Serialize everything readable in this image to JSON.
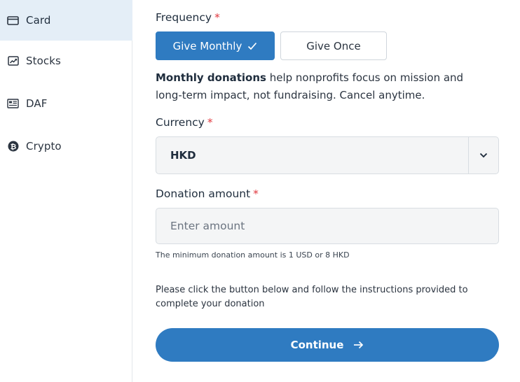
{
  "sidebar": {
    "items": [
      {
        "label": "Card",
        "icon": "credit-card-icon",
        "active": true
      },
      {
        "label": "Stocks",
        "icon": "stock-chart-icon",
        "active": false
      },
      {
        "label": "DAF",
        "icon": "daf-document-icon",
        "active": false
      },
      {
        "label": "Crypto",
        "icon": "bitcoin-icon",
        "active": false
      }
    ]
  },
  "form": {
    "frequency": {
      "label": "Frequency",
      "required_mark": "*",
      "options": [
        {
          "label": "Give Monthly",
          "selected": true
        },
        {
          "label": "Give Once",
          "selected": false
        }
      ],
      "description_bold": "Monthly donations",
      "description_rest": " help nonprofits focus on mission and long-term impact, not fundraising. Cancel anytime."
    },
    "currency": {
      "label": "Currency",
      "required_mark": "*",
      "value": "HKD"
    },
    "amount": {
      "label": "Donation amount",
      "required_mark": "*",
      "placeholder": "Enter amount",
      "value": "",
      "hint": "The minimum donation amount is 1 USD or 8 HKD"
    },
    "instructions": "Please click the button below and follow the instructions provided to complete your donation",
    "continue_label": "Continue"
  },
  "colors": {
    "primary": "#2f7bc1",
    "active_sidebar_bg": "#e4eef7",
    "required": "#e0383e",
    "input_bg": "#f4f5f6"
  }
}
